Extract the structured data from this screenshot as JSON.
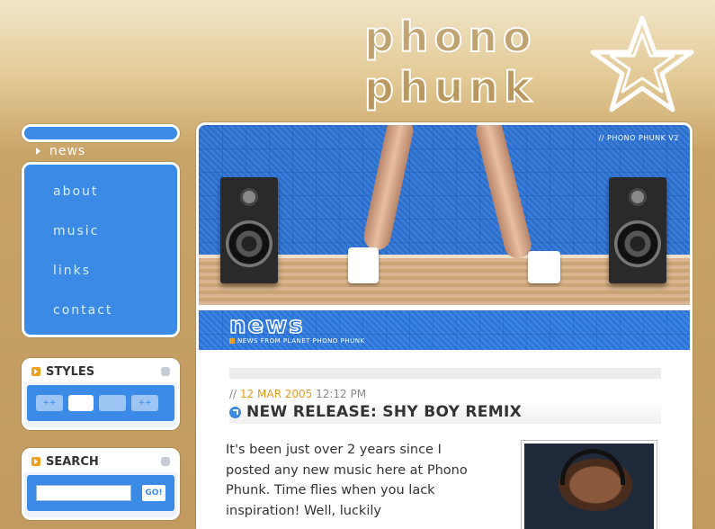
{
  "logo": {
    "line1": "phono",
    "line2": "phunk"
  },
  "nav": {
    "current": "news",
    "items": [
      "about",
      "music",
      "links",
      "contact"
    ]
  },
  "styles_box": {
    "title": "STYLES",
    "buttons": [
      "++",
      "",
      "",
      "++"
    ]
  },
  "search_box": {
    "title": "SEARCH",
    "placeholder": "",
    "button": "GO!"
  },
  "hero": {
    "tag": "// PHONO PHUNK V2"
  },
  "news": {
    "title": "news",
    "subtitle": "NEWS FROM PLANET PHONO PHUNK"
  },
  "post": {
    "date_prefix": "//",
    "date": "12 MAR 2005",
    "time": "12:12 PM",
    "title": "NEW RELEASE: SHY BOY REMIX",
    "body": "It's been just over 2 years since I posted any new music here at Phono Phunk. Time flies when you lack inspiration! Well, luckily"
  },
  "colors": {
    "accent_blue": "#3a8ae6",
    "accent_orange": "#e49a1a",
    "background_tan": "#c9a468"
  }
}
